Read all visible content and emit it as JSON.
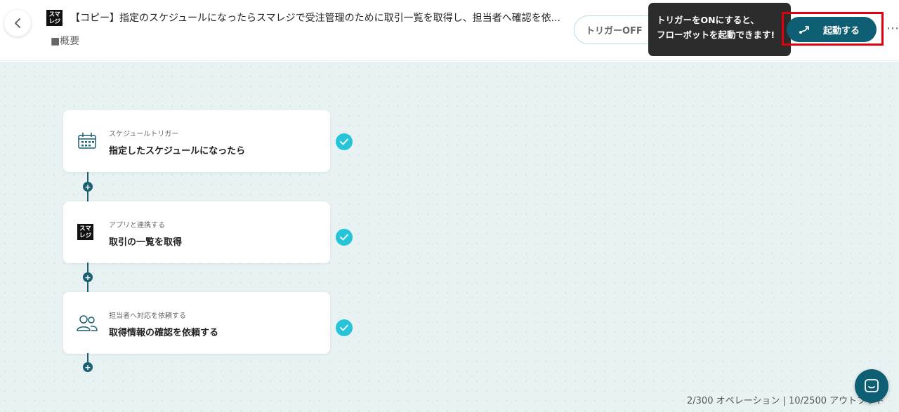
{
  "header": {
    "app_logo_text": "スマレジ",
    "title": "【コピー】指定のスケジュールになったらスマレジで受注管理のために取引一覧を取得し、担当者へ確認を依...",
    "summary_link": "■概要",
    "trigger_toggle_label": "トリガーOFF",
    "tooltip_line1": "トリガーをONにすると、",
    "tooltip_line2": "フローボットを起動できます!",
    "launch_label": "起動する",
    "more_icon": "more-horizontal-icon"
  },
  "steps": [
    {
      "type": "スケジュールトリガー",
      "name": "指定したスケジュールになったら",
      "icon": "calendar-icon",
      "status": "complete"
    },
    {
      "type": "アプリと連携する",
      "name": "取引の一覧を取得",
      "icon": "smaregi-logo-icon",
      "status": "complete",
      "logo_text": "スマレジ"
    },
    {
      "type": "担当者へ対応を依頼する",
      "name": "取得情報の確認を依頼する",
      "icon": "users-icon",
      "status": "complete"
    }
  ],
  "usage": {
    "text": "2/300 オペレーション | 10/2500 アウトプット"
  },
  "colors": {
    "accent": "#0f5f74",
    "check": "#25c4d8",
    "canvas_bg": "#e9f2f2",
    "highlight": "#e00010"
  }
}
